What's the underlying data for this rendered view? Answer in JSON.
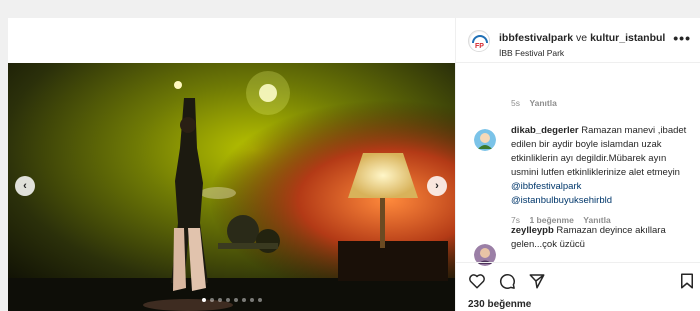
{
  "post": {
    "account": "ibbfestivalpark",
    "connector": "ve",
    "collab": "kultur_istanbul",
    "location": "İBB Festival Park",
    "more_label": "•••",
    "likes": "230 beğenme"
  },
  "owner_reply": {
    "time": "5s",
    "reply_label": "Yanıtla"
  },
  "comments": [
    {
      "user": "dikab_degerler",
      "text": "Ramazan manevi ,ibadet edilen bir aydir boyle islamdan uzak etkinliklerin ayı degildir.Mübarek ayın usmini lutfen etkinliklerinize alet etmeyin",
      "mentions": [
        "@ibbfestivalpark",
        "@istanbulbuyuksehirbld"
      ],
      "time": "7s",
      "likes": "1 beğenme",
      "reply_label": "Yanıtla"
    },
    {
      "user": "zeylleypb",
      "text": "Ramazan deyince akıllara gelen...çok üzücü"
    }
  ],
  "carousel": {
    "slide_count": 8,
    "active_index": 0,
    "prev_glyph": "‹",
    "next_glyph": "›"
  },
  "icons": [
    "heart-icon",
    "comment-icon",
    "share-icon",
    "save-icon"
  ],
  "colors": {
    "mention": "#00376b",
    "meta": "#8e8e8e",
    "stage_green": "#8fa100"
  }
}
